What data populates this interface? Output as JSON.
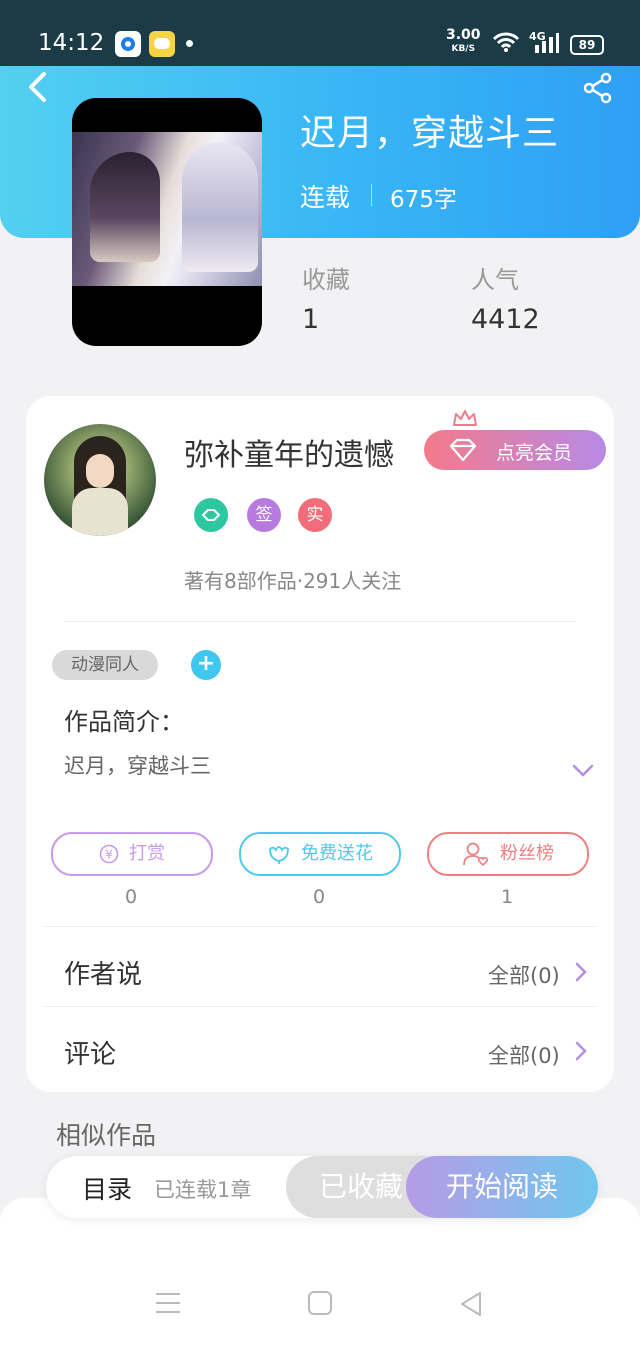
{
  "status_bar": {
    "time": "14:12",
    "net_speed": "3.00",
    "net_unit": "KB/S",
    "signal": "4G",
    "battery": "89"
  },
  "header": {
    "title": "迟月，穿越斗三",
    "status": "连载",
    "word_count": "675字"
  },
  "stats": [
    {
      "label": "收藏",
      "value": "1"
    },
    {
      "label": "人气",
      "value": "4412"
    }
  ],
  "author": {
    "name": "弥补童年的遗憾",
    "vip_button": "点亮会员",
    "badges": [
      {
        "text": "",
        "color": "#2fc7a0"
      },
      {
        "text": "签",
        "color": "#b77be0"
      },
      {
        "text": "实",
        "color": "#f26d7b"
      }
    ],
    "works_info": "著有8部作品·291人关注"
  },
  "tag": "动漫同人",
  "intro": {
    "label": "作品简介：",
    "text": "迟月，穿越斗三"
  },
  "actions": [
    {
      "label": "打赏",
      "count": "0",
      "color": "#c79be8"
    },
    {
      "label": "免费送花",
      "count": "0",
      "color": "#4ec9ea"
    },
    {
      "label": "粉丝榜",
      "count": "1",
      "color": "#f08080"
    }
  ],
  "rows": [
    {
      "label": "作者说",
      "value": "全部(0)"
    },
    {
      "label": "评论",
      "value": "全部(0)"
    }
  ],
  "similar_title": "相似作品",
  "bottom_bar": {
    "toc": "目录",
    "chapter_info": "已连载1章",
    "collected": "已收藏",
    "read": "开始阅读"
  }
}
